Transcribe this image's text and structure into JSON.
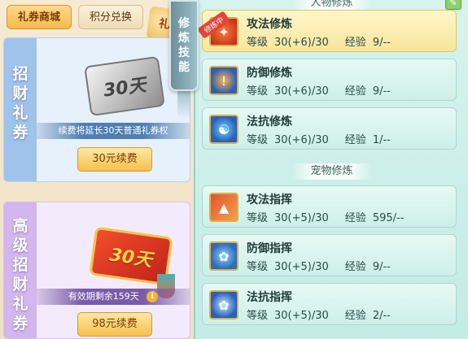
{
  "left": {
    "tabs": [
      {
        "label": "礼券商城",
        "active": true
      },
      {
        "label": "积分兑换",
        "active": false
      }
    ],
    "corner_badge": "礼",
    "cards": [
      {
        "vertical_title": [
          "招",
          "财",
          "礼",
          "券"
        ],
        "ticket_text": "30天",
        "strip_text": "续费将延长30天普通礼券权",
        "button_label": "30元续费"
      },
      {
        "vertical_title": [
          "高",
          "级",
          "招",
          "财",
          "礼",
          "券"
        ],
        "ticket_text": "30天",
        "strip_text": "有效期剩余159天",
        "button_label": "98元续费"
      }
    ]
  },
  "right": {
    "scroll_tab": [
      "修",
      "炼",
      "技",
      "能"
    ],
    "section_people": "人物修炼",
    "section_pet": "宠物修炼",
    "level_label": "等级",
    "exp_label": "经验",
    "cultivating_badge": "修炼中",
    "edit_icon": "edit-icon",
    "people": [
      {
        "name": "攻法修炼",
        "level": "30(+6)/30",
        "exp": "9/--",
        "icon": "attack-magic-icon",
        "selected": true
      },
      {
        "name": "防御修炼",
        "level": "30(+6)/30",
        "exp": "9/--",
        "icon": "defense-shield-icon",
        "selected": false
      },
      {
        "name": "法抗修炼",
        "level": "30(+6)/30",
        "exp": "1/--",
        "icon": "resist-yinyang-icon",
        "selected": false
      }
    ],
    "pet": [
      {
        "name": "攻法指挥",
        "level": "30(+5)/30",
        "exp": "595/--",
        "icon": "pet-attack-icon"
      },
      {
        "name": "防御指挥",
        "level": "30(+5)/30",
        "exp": "9/--",
        "icon": "pet-defense-paw-icon"
      },
      {
        "name": "法抗指挥",
        "level": "30(+5)/30",
        "exp": "2/--",
        "icon": "pet-resist-paw-icon"
      }
    ]
  }
}
